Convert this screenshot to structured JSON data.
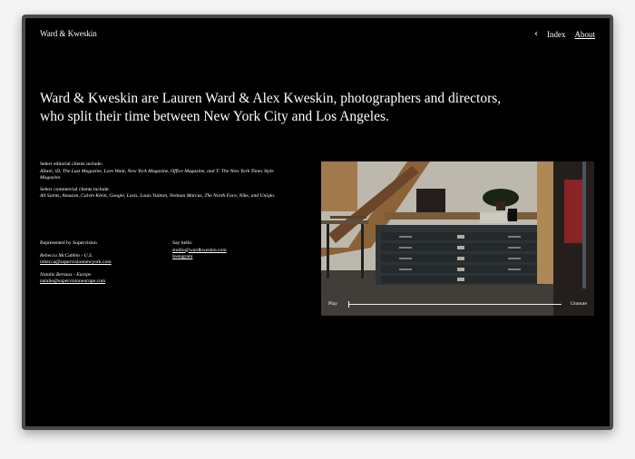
{
  "header": {
    "brand": "Ward & Kweskin",
    "nav": {
      "back_icon": "chevron-left-icon",
      "index": "Index",
      "about": "About"
    }
  },
  "headline": "Ward & Kweskin are Lauren Ward & Alex Kweskin, photographers and directors, who split their time between New York City and Los Angeles.",
  "clients": {
    "editorial_heading": "Select editorial clients include:",
    "editorial_list": "Allure, iD, The Last Magazine, Lore Want, New York Magazine, Office Magazine, and T: The New York Times Style Magazine.",
    "commercial_heading": "Select commercial clients include:",
    "commercial_list": "All Saints, Amazon, Calvin Klein, Google, Lexis, Louis Vuitton, Neiman Marcus, The North Face, Nike, and Uniqlo."
  },
  "representation": {
    "title": "Represented by Supervision",
    "contacts": [
      {
        "name": "Rebecca McCubbin - U.S.",
        "email": "rebecca@supervisionnewyork.com"
      },
      {
        "name": "Natalie Bertaux - Europe",
        "email": "natalie@supervisioneurope.com"
      }
    ]
  },
  "hello": {
    "title": "Say hello:",
    "email": "studio@wardkweskin.com",
    "instagram": "Instagram"
  },
  "video": {
    "play": "Play",
    "unmute": "Unmute",
    "progress": 0
  }
}
